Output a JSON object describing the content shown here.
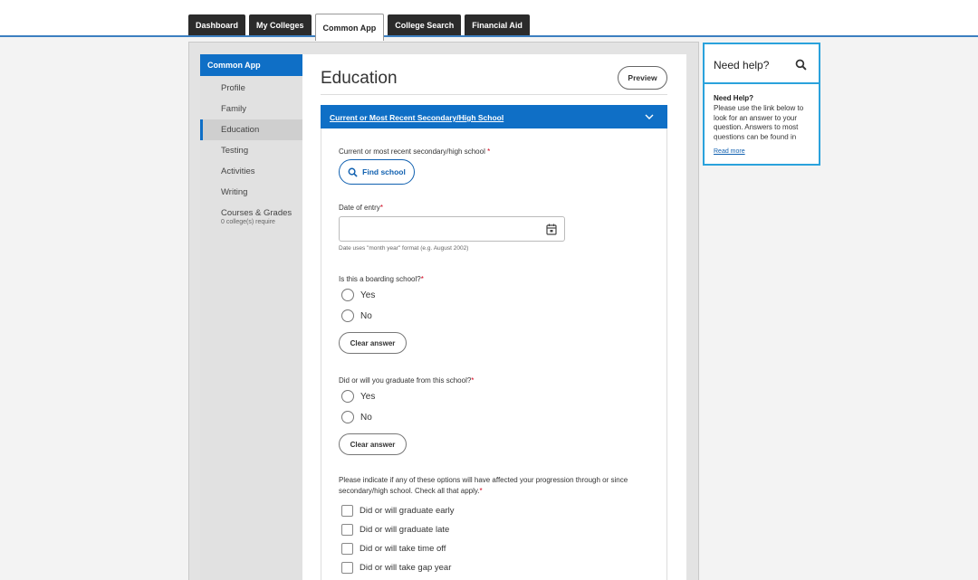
{
  "tabs": [
    {
      "label": "Dashboard"
    },
    {
      "label": "My Colleges"
    },
    {
      "label": "Common App"
    },
    {
      "label": "College Search"
    },
    {
      "label": "Financial Aid"
    }
  ],
  "sidebar": {
    "header": "Common App",
    "items": [
      {
        "label": "Profile"
      },
      {
        "label": "Family"
      },
      {
        "label": "Education"
      },
      {
        "label": "Testing"
      },
      {
        "label": "Activities"
      },
      {
        "label": "Writing"
      },
      {
        "label": "Courses & Grades",
        "sub": "0 college(s) require"
      }
    ]
  },
  "main": {
    "title": "Education",
    "preview_label": "Preview",
    "section_title": "Current or Most Recent Secondary/High School",
    "school_q": "Current or most recent secondary/high school",
    "find_school_label": "Find school",
    "date_q": "Date of entry",
    "date_hint": "Date uses \"month year\" format (e.g. August 2002)",
    "boarding_q": "Is this a boarding school?",
    "graduate_q": "Did or will you graduate from this school?",
    "yes_label": "Yes",
    "no_label": "No",
    "clear_label": "Clear answer",
    "progress_q": "Please indicate if any of these options will have affected your progression through or since secondary/high school. Check all that apply.",
    "progress_options": [
      "Did or will graduate early",
      "Did or will graduate late",
      "Did or will take time off",
      "Did or will take gap year"
    ]
  },
  "help": {
    "title": "Need help?",
    "subtitle": "Need Help?",
    "text": "Please use the link below to look for an answer to your question. Answers to most questions can be found in",
    "link": "Read more"
  },
  "colors": {
    "accent": "#0f6fc6",
    "help_border": "#2aa2dc",
    "required": "#d0021b"
  }
}
